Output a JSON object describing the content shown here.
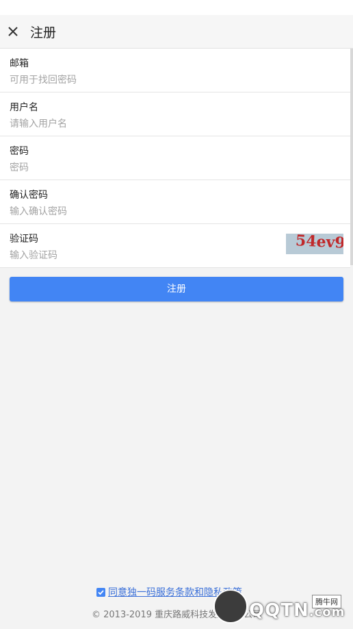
{
  "toolbar": {
    "title": "注册",
    "close_icon": "close-icon"
  },
  "form": {
    "email": {
      "label": "邮箱",
      "placeholder": "可用于找回密码"
    },
    "username": {
      "label": "用户名",
      "placeholder": "请输入用户名"
    },
    "password": {
      "label": "密码",
      "placeholder": "密码"
    },
    "confirm_password": {
      "label": "确认密码",
      "placeholder": "输入确认密码"
    },
    "captcha": {
      "label": "验证码",
      "placeholder": "输入验证码",
      "image_text": "54ev9"
    }
  },
  "submit": {
    "label": "注册"
  },
  "agreement": {
    "checked": true,
    "label": "同意独一码服务条款和隐私政策"
  },
  "footer": {
    "copyright": "© 2013-2019 重庆路威科技发展有限公司"
  },
  "watermark": {
    "text": "QQTN",
    "suffix": ".com",
    "badge": "腾牛网"
  },
  "colors": {
    "accent": "#4285f4",
    "link": "#3a6fd8",
    "captcha_text": "#c0282a"
  }
}
